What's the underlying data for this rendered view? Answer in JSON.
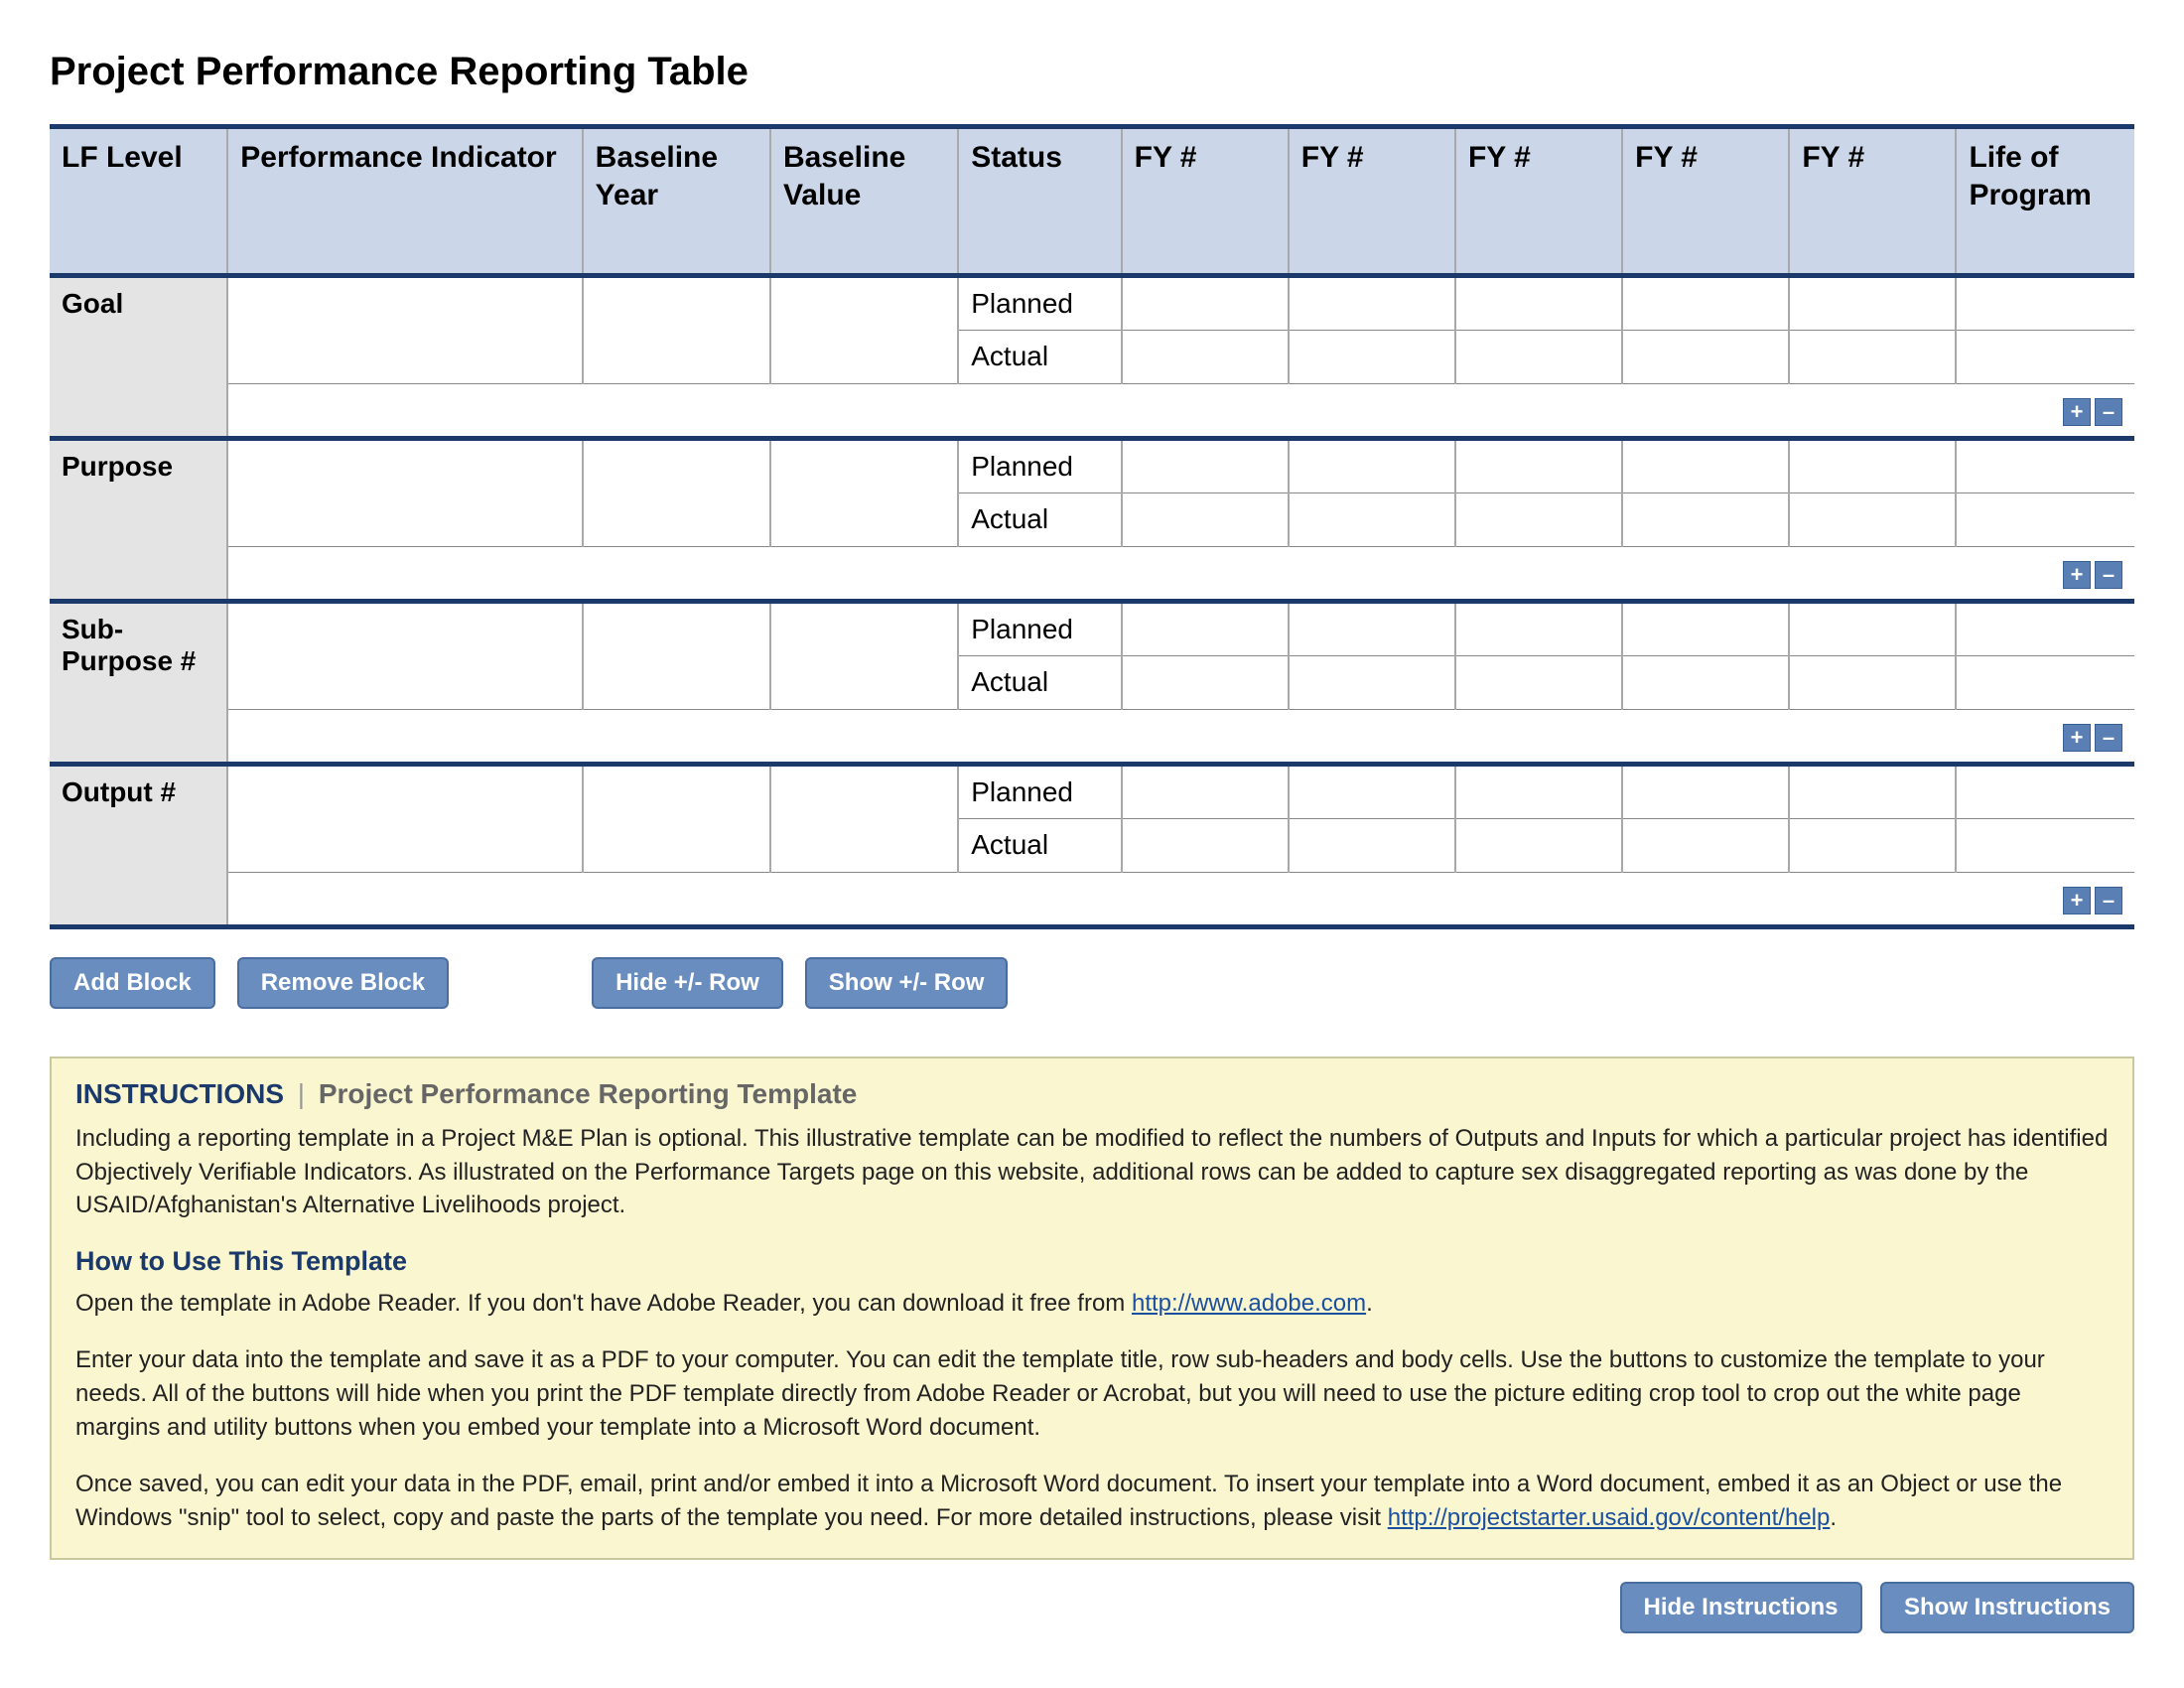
{
  "title": "Project Performance Reporting Table",
  "columns": {
    "lf": "LF Level",
    "pi": "Performance Indicator",
    "by": "Baseline Year",
    "bv": "Baseline Value",
    "status": "Status",
    "fy1": "FY #",
    "fy2": "FY #",
    "fy3": "FY #",
    "fy4": "FY #",
    "fy5": "FY #",
    "lop": "Life of Program"
  },
  "status_labels": {
    "planned": "Planned",
    "actual": "Actual"
  },
  "sections": [
    {
      "label": "Goal"
    },
    {
      "label": "Purpose"
    },
    {
      "label": "Sub-Purpose #"
    },
    {
      "label": "Output #"
    }
  ],
  "row_controls": {
    "plus": "+",
    "minus": "–"
  },
  "buttons": {
    "add_block": "Add Block",
    "remove_block": "Remove Block",
    "hide_pm_row": "Hide +/- Row",
    "show_pm_row": "Show +/- Row",
    "hide_instructions": "Hide Instructions",
    "show_instructions": "Show Instructions"
  },
  "instructions": {
    "lead": "INSTRUCTIONS",
    "subtitle": "Project Performance Reporting Template",
    "para1": "Including a reporting template in a Project M&E Plan is optional. This illustrative template can be modified to reflect the numbers of Outputs and Inputs for which a particular project has identified Objectively Verifiable Indicators. As illustrated on the Performance Targets page on this website, additional rows can be added to capture sex disaggregated reporting as was done by the USAID/Afghanistan's Alternative Livelihoods project.",
    "howto_heading": "How to Use This Template",
    "para2a": "Open the template in Adobe Reader. If you don't have Adobe Reader, you can download it free from ",
    "link1_text": "http://www.adobe.com",
    "para2b": ".",
    "para3": "Enter your data into the template and save it as a PDF to your computer. You can edit the template title, row sub-headers and body cells. Use the buttons to customize the template to your needs. All of the buttons will hide when you print the PDF template directly from Adobe Reader or Acrobat, but you will need to use the picture editing crop tool to crop out the white page margins and utility buttons when you embed your template into a Microsoft Word document.",
    "para4a": "Once saved, you can edit your data in the PDF, email, print and/or embed it into a Microsoft Word document. To insert your template into a Word document, embed it as an Object or use the Windows \"snip\" tool to select, copy and paste the parts of the template you need. For more detailed instructions, please visit ",
    "link2_text": "http://projectstarter.usaid.gov/content/help",
    "para4b": "."
  }
}
